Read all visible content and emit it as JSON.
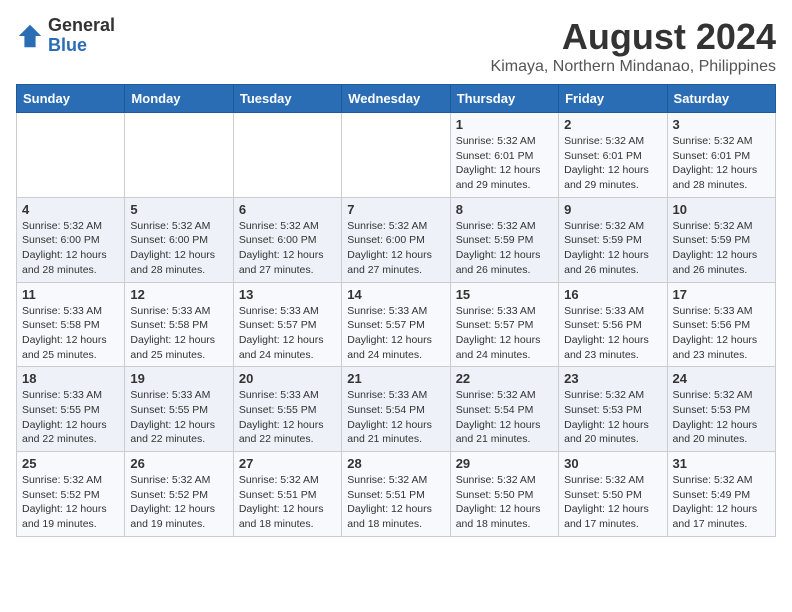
{
  "logo": {
    "general": "General",
    "blue": "Blue"
  },
  "title": {
    "month": "August 2024",
    "location": "Kimaya, Northern Mindanao, Philippines"
  },
  "headers": [
    "Sunday",
    "Monday",
    "Tuesday",
    "Wednesday",
    "Thursday",
    "Friday",
    "Saturday"
  ],
  "weeks": [
    [
      {
        "day": "",
        "content": ""
      },
      {
        "day": "",
        "content": ""
      },
      {
        "day": "",
        "content": ""
      },
      {
        "day": "",
        "content": ""
      },
      {
        "day": "1",
        "content": "Sunrise: 5:32 AM\nSunset: 6:01 PM\nDaylight: 12 hours\nand 29 minutes."
      },
      {
        "day": "2",
        "content": "Sunrise: 5:32 AM\nSunset: 6:01 PM\nDaylight: 12 hours\nand 29 minutes."
      },
      {
        "day": "3",
        "content": "Sunrise: 5:32 AM\nSunset: 6:01 PM\nDaylight: 12 hours\nand 28 minutes."
      }
    ],
    [
      {
        "day": "4",
        "content": "Sunrise: 5:32 AM\nSunset: 6:00 PM\nDaylight: 12 hours\nand 28 minutes."
      },
      {
        "day": "5",
        "content": "Sunrise: 5:32 AM\nSunset: 6:00 PM\nDaylight: 12 hours\nand 28 minutes."
      },
      {
        "day": "6",
        "content": "Sunrise: 5:32 AM\nSunset: 6:00 PM\nDaylight: 12 hours\nand 27 minutes."
      },
      {
        "day": "7",
        "content": "Sunrise: 5:32 AM\nSunset: 6:00 PM\nDaylight: 12 hours\nand 27 minutes."
      },
      {
        "day": "8",
        "content": "Sunrise: 5:32 AM\nSunset: 5:59 PM\nDaylight: 12 hours\nand 26 minutes."
      },
      {
        "day": "9",
        "content": "Sunrise: 5:32 AM\nSunset: 5:59 PM\nDaylight: 12 hours\nand 26 minutes."
      },
      {
        "day": "10",
        "content": "Sunrise: 5:32 AM\nSunset: 5:59 PM\nDaylight: 12 hours\nand 26 minutes."
      }
    ],
    [
      {
        "day": "11",
        "content": "Sunrise: 5:33 AM\nSunset: 5:58 PM\nDaylight: 12 hours\nand 25 minutes."
      },
      {
        "day": "12",
        "content": "Sunrise: 5:33 AM\nSunset: 5:58 PM\nDaylight: 12 hours\nand 25 minutes."
      },
      {
        "day": "13",
        "content": "Sunrise: 5:33 AM\nSunset: 5:57 PM\nDaylight: 12 hours\nand 24 minutes."
      },
      {
        "day": "14",
        "content": "Sunrise: 5:33 AM\nSunset: 5:57 PM\nDaylight: 12 hours\nand 24 minutes."
      },
      {
        "day": "15",
        "content": "Sunrise: 5:33 AM\nSunset: 5:57 PM\nDaylight: 12 hours\nand 24 minutes."
      },
      {
        "day": "16",
        "content": "Sunrise: 5:33 AM\nSunset: 5:56 PM\nDaylight: 12 hours\nand 23 minutes."
      },
      {
        "day": "17",
        "content": "Sunrise: 5:33 AM\nSunset: 5:56 PM\nDaylight: 12 hours\nand 23 minutes."
      }
    ],
    [
      {
        "day": "18",
        "content": "Sunrise: 5:33 AM\nSunset: 5:55 PM\nDaylight: 12 hours\nand 22 minutes."
      },
      {
        "day": "19",
        "content": "Sunrise: 5:33 AM\nSunset: 5:55 PM\nDaylight: 12 hours\nand 22 minutes."
      },
      {
        "day": "20",
        "content": "Sunrise: 5:33 AM\nSunset: 5:55 PM\nDaylight: 12 hours\nand 22 minutes."
      },
      {
        "day": "21",
        "content": "Sunrise: 5:33 AM\nSunset: 5:54 PM\nDaylight: 12 hours\nand 21 minutes."
      },
      {
        "day": "22",
        "content": "Sunrise: 5:32 AM\nSunset: 5:54 PM\nDaylight: 12 hours\nand 21 minutes."
      },
      {
        "day": "23",
        "content": "Sunrise: 5:32 AM\nSunset: 5:53 PM\nDaylight: 12 hours\nand 20 minutes."
      },
      {
        "day": "24",
        "content": "Sunrise: 5:32 AM\nSunset: 5:53 PM\nDaylight: 12 hours\nand 20 minutes."
      }
    ],
    [
      {
        "day": "25",
        "content": "Sunrise: 5:32 AM\nSunset: 5:52 PM\nDaylight: 12 hours\nand 19 minutes."
      },
      {
        "day": "26",
        "content": "Sunrise: 5:32 AM\nSunset: 5:52 PM\nDaylight: 12 hours\nand 19 minutes."
      },
      {
        "day": "27",
        "content": "Sunrise: 5:32 AM\nSunset: 5:51 PM\nDaylight: 12 hours\nand 18 minutes."
      },
      {
        "day": "28",
        "content": "Sunrise: 5:32 AM\nSunset: 5:51 PM\nDaylight: 12 hours\nand 18 minutes."
      },
      {
        "day": "29",
        "content": "Sunrise: 5:32 AM\nSunset: 5:50 PM\nDaylight: 12 hours\nand 18 minutes."
      },
      {
        "day": "30",
        "content": "Sunrise: 5:32 AM\nSunset: 5:50 PM\nDaylight: 12 hours\nand 17 minutes."
      },
      {
        "day": "31",
        "content": "Sunrise: 5:32 AM\nSunset: 5:49 PM\nDaylight: 12 hours\nand 17 minutes."
      }
    ]
  ]
}
